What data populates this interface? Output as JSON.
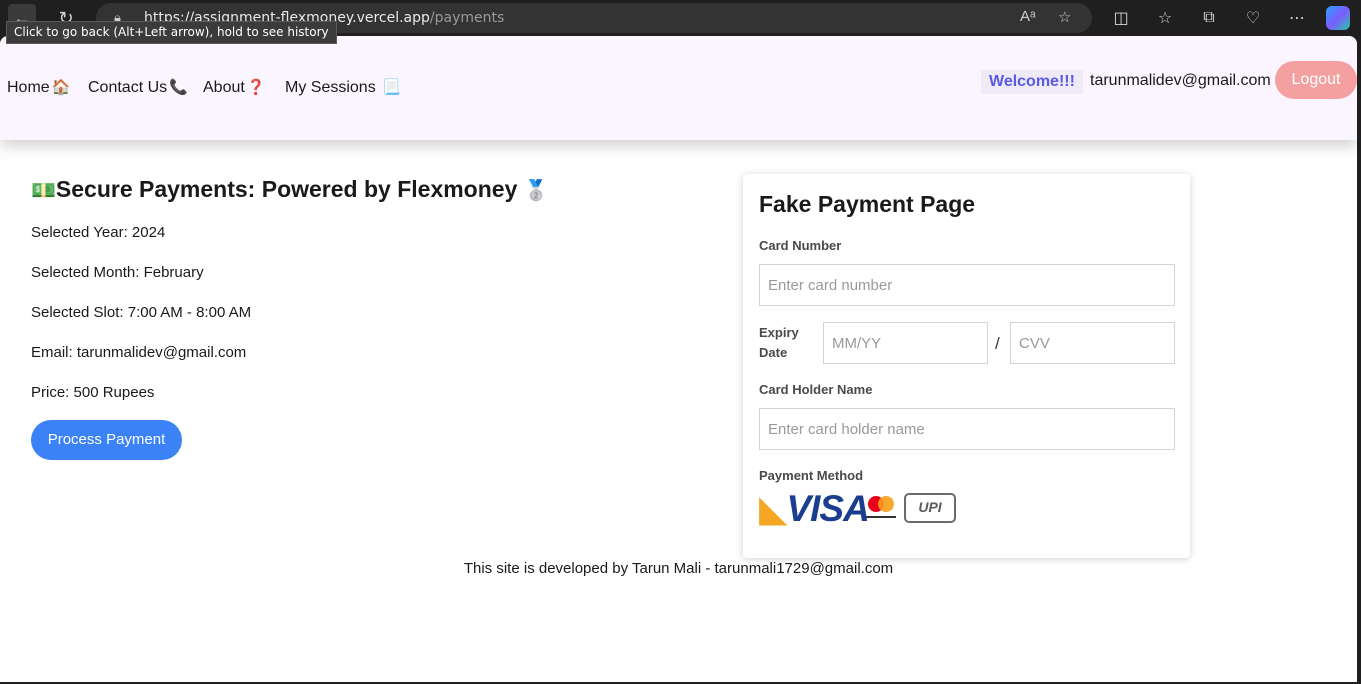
{
  "browser": {
    "url_host": "https://assignment-flexmoney.vercel.app",
    "url_path": "/payments",
    "tooltip": "Click to go back (Alt+Left arrow), hold to see history",
    "icons": [
      "back-arrow-icon",
      "refresh-icon",
      "lock-icon",
      "read-aloud-icon",
      "favorite-star-icon",
      "split-screen-icon",
      "favorites-icon",
      "collections-icon",
      "browser-essentials-icon",
      "more-icon",
      "copilot-icon"
    ]
  },
  "nav": {
    "links": [
      {
        "label": "Home",
        "emoji": "🏠"
      },
      {
        "label": "Contact Us",
        "emoji": "📞"
      },
      {
        "label": "About",
        "emoji": "❓"
      },
      {
        "label": "My Sessions",
        "emoji": "📃"
      }
    ],
    "welcome": "Welcome!!!",
    "email": "tarunmalidev@gmail.com",
    "logout": "Logout"
  },
  "main": {
    "heading_emoji_left": "💵",
    "heading": "Secure Payments: Powered by Flexmoney",
    "heading_emoji_right": "🥈",
    "info": [
      "Selected Year: 2024",
      "Selected Month: February",
      "Selected Slot: 7:00 AM - 8:00 AM",
      "Email: tarunmalidev@gmail.com",
      "Price: 500 Rupees"
    ],
    "process_button": "Process Payment"
  },
  "payment_form": {
    "title": "Fake Payment Page",
    "card_number_label": "Card Number",
    "card_number_placeholder": "Enter card number",
    "expiry_label": "Expiry Date",
    "expiry_placeholder": "MM/YY",
    "separator": "/",
    "cvv_placeholder": "CVV",
    "holder_label": "Card Holder Name",
    "holder_placeholder": "Enter card holder name",
    "method_label": "Payment Method",
    "methods": [
      "VISA",
      "mastercard",
      "UPI"
    ]
  },
  "footer": "This site is developed by Tarun Mali - tarunmali1729@gmail.com",
  "colors": {
    "navbar_bg": "#fbf5ff",
    "welcome_text": "#5a5ae6",
    "logout_bg": "#f4a0a0",
    "process_bg": "#3b82f6"
  }
}
